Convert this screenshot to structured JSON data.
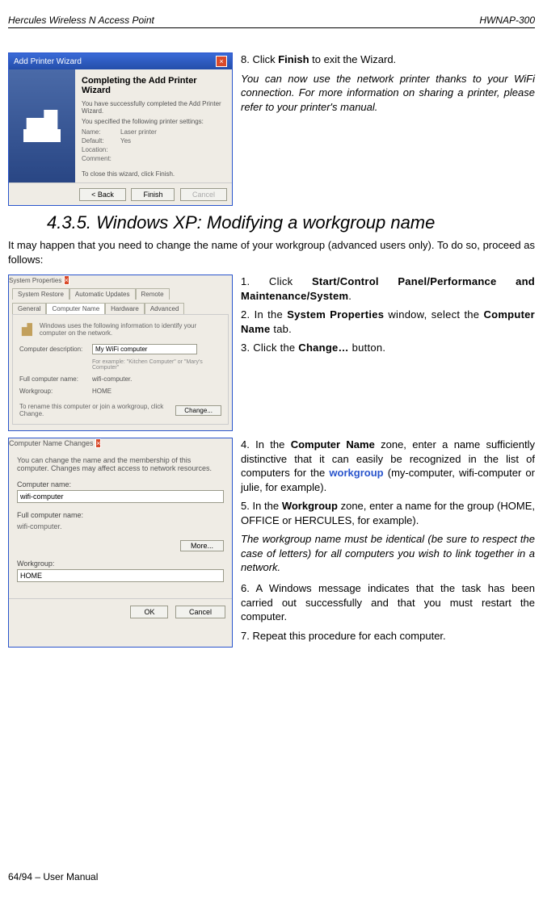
{
  "header": {
    "left": "Hercules Wireless N Access Point",
    "right": "HWNAP-300"
  },
  "wizard": {
    "title": "Add Printer Wizard",
    "heading": "Completing the Add Printer Wizard",
    "intro": "You have successfully completed the Add Printer Wizard.",
    "settings_intro": "You specified the following printer settings:",
    "kv": {
      "name_label": "Name:",
      "name_value": "Laser printer",
      "default_label": "Default:",
      "default_value": "Yes",
      "location_label": "Location:",
      "location_value": "",
      "comment_label": "Comment:",
      "comment_value": ""
    },
    "close_text": "To close this wizard, click Finish.",
    "back": "< Back",
    "finish": "Finish",
    "cancel": "Cancel"
  },
  "block1": {
    "step8": "8.   Click ",
    "step8b": "Finish",
    "step8c": " to exit the Wizard.",
    "note": "You can now use the network printer thanks to your WiFi connection.  For more information on sharing a printer, please refer to your printer's manual."
  },
  "section_heading": "4.3.5. Windows XP: Modifying a workgroup name",
  "intro_text": "It may happen that you need to change the name of your workgroup (advanced users only).  To do so, proceed as follows:",
  "sysprop": {
    "title": "System Properties",
    "tabs_row1": [
      "System Restore",
      "Automatic Updates",
      "Remote"
    ],
    "tabs_row2": [
      "General",
      "Computer Name",
      "Hardware",
      "Advanced"
    ],
    "info": "Windows uses the following information to identify your computer on the network.",
    "desc_label": "Computer description:",
    "desc_value": "My WiFi computer",
    "desc_hint": "For example: \"Kitchen Computer\" or \"Mary's Computer\"",
    "full_label": "Full computer name:",
    "full_value": "wifi-computer.",
    "wg_label": "Workgroup:",
    "wg_value": "HOME",
    "change_text": "To rename this computer or join a workgroup, click Change.",
    "change_btn": "Change..."
  },
  "namechg": {
    "title": "Computer Name Changes",
    "intro": "You can change the name and the membership of this computer. Changes may affect access to network resources.",
    "cname_label": "Computer name:",
    "cname_value": "wifi-computer",
    "full_label": "Full computer name:",
    "full_value": "wifi-computer.",
    "more_btn": "More...",
    "wg_label": "Workgroup:",
    "wg_value": "HOME",
    "ok": "OK",
    "cancel": "Cancel"
  },
  "steps_a": {
    "s1a": "1.  Click ",
    "s1b": "Start/Control Panel/Performance and Maintenance/System",
    "s1c": ".",
    "s2a": "2.  In the ",
    "s2b": "System Properties",
    "s2c": " window, select the ",
    "s2d": "Computer Name",
    "s2e": " tab.",
    "s3a": "3.  Click the ",
    "s3b": "Change…",
    "s3c": " button."
  },
  "steps_b": {
    "s4a": "4.  In the ",
    "s4b": "Computer Name",
    "s4c": " zone, enter a name sufficiently distinctive that it can easily be recognized in the list of computers for the ",
    "s4d": "workgroup",
    "s4e": " (my-computer, wifi-computer or julie, for example).",
    "s5a": "5.  In the ",
    "s5b": "Workgroup",
    "s5c": " zone, enter a name for the group (HOME, OFFICE or HERCULES, for example).",
    "note": "The workgroup name must be identical (be sure to respect the case of letters) for all computers you wish to link together in a network.",
    "s6": "6.  A Windows message indicates that the task has been carried out successfully and that you must restart the computer.",
    "s7": "7.  Repeat this procedure for each computer."
  },
  "footer": "64/94 – User Manual"
}
